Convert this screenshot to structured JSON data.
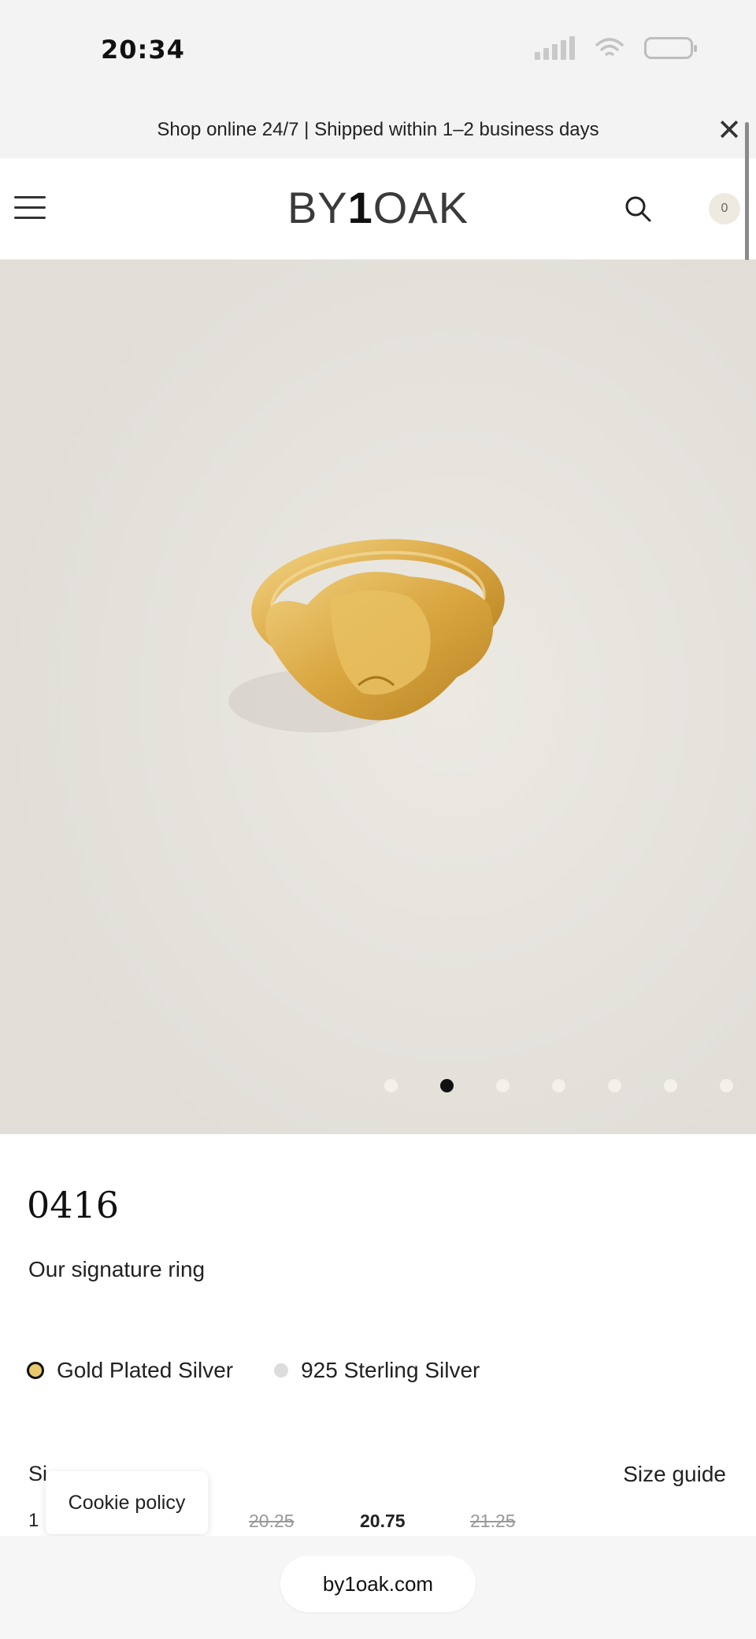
{
  "status_bar": {
    "time": "20:34",
    "signal_icon": "signal-icon",
    "wifi_icon": "wifi-icon",
    "battery_icon": "battery-icon"
  },
  "announcement": {
    "text": "Shop online 24/7 | Shipped within 1–2 business days",
    "close_label": "✕"
  },
  "header": {
    "logo_prefix": "BY",
    "logo_one": "1",
    "logo_suffix": "OAK",
    "cart_count": "0"
  },
  "product": {
    "image_alt": "Gold signet ring",
    "carousel": {
      "total": 7,
      "active": 2
    },
    "name": "0416",
    "tagline": "Our signature ring",
    "variants": [
      {
        "label": "Gold Plated Silver",
        "color": "#e8c86a",
        "selected": true
      },
      {
        "label": "925 Sterling Silver",
        "color": "#dcdcdc",
        "selected": false
      }
    ],
    "size_label": "Si",
    "size_first_partial": "1",
    "sizes": [
      {
        "label": "20.25",
        "available": false
      },
      {
        "label": "20.75",
        "available": true
      },
      {
        "label": "21.25",
        "available": false
      }
    ],
    "size_guide": "Size guide"
  },
  "cookie": {
    "label": "Cookie policy"
  },
  "browser": {
    "url": "by1oak.com"
  },
  "colors": {
    "image_bg": "#e6e4df",
    "gold": "#d9a640",
    "active_dot": "#111111"
  }
}
